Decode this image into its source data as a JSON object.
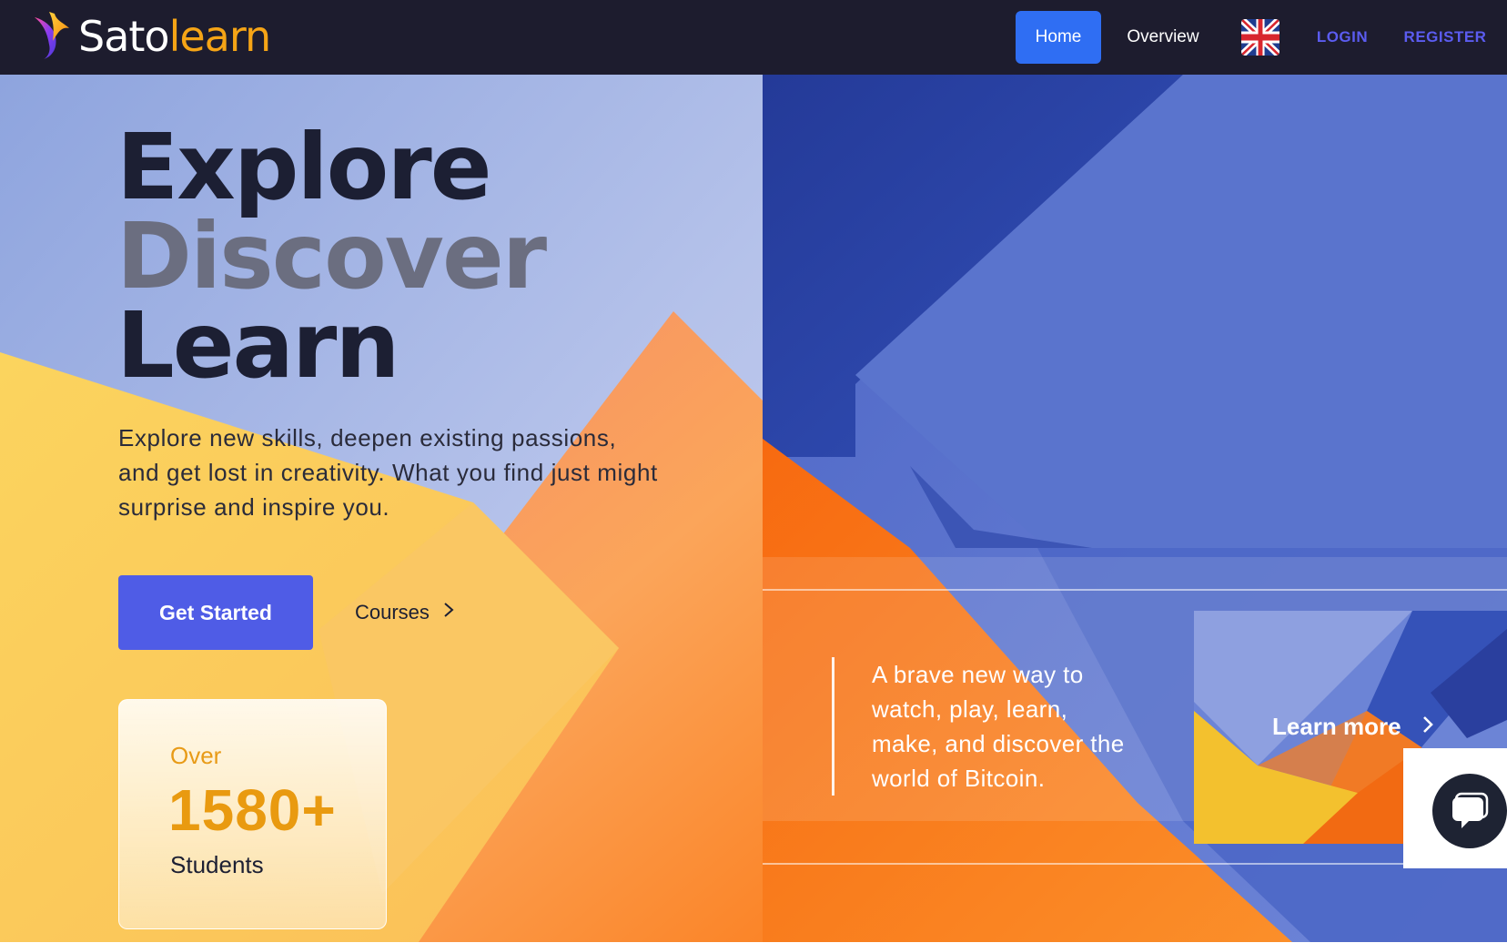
{
  "brand": {
    "part1": "Sato",
    "part2": "learn"
  },
  "nav": {
    "home": "Home",
    "overview": "Overview",
    "login": "LOGIN",
    "register": "REGISTER"
  },
  "hero": {
    "line1": "Explore",
    "line2": "Discover",
    "line3": "Learn",
    "description": "Explore new skills, deepen existing passions, and get lost in creativity. What you find just might surprise and inspire you.",
    "cta_primary": "Get Started",
    "cta_secondary": "Courses"
  },
  "stats": {
    "over": "Over",
    "number": "1580+",
    "label": "Students"
  },
  "promo": {
    "tagline": "A brave new way to watch, play, learn, make, and discover the world of Bitcoin.",
    "learn_more": "Learn more"
  },
  "icons": {
    "logo": "bird-logo-icon",
    "language": "uk-flag-icon",
    "courses_arrow": "chevron-right-icon",
    "learn_more_arrow": "chevron-right-icon",
    "chat": "chat-bubble-icon"
  },
  "colors": {
    "nav_bg": "#1d1c2e",
    "accent_blue": "#2f6ef3",
    "primary_button": "#4f5ce6",
    "brand_orange": "#f5a416",
    "link_purple": "#5b5cf0"
  }
}
